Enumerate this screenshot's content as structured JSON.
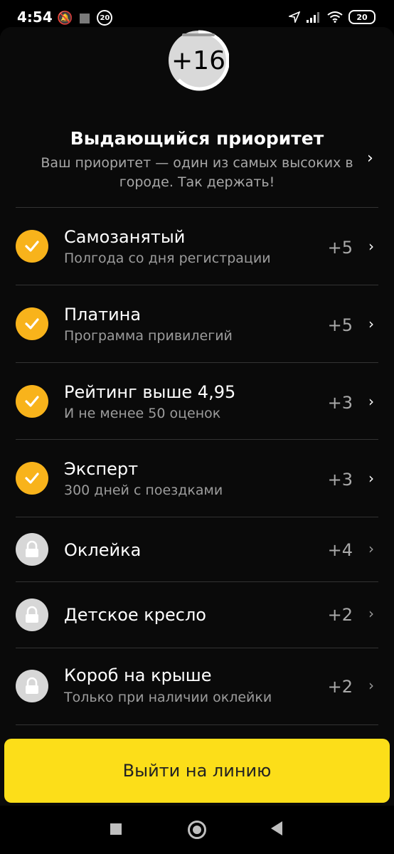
{
  "status_bar": {
    "time": "4:54",
    "badge": "20",
    "battery": "20"
  },
  "score": {
    "value": "+16"
  },
  "header": {
    "title": "Выдающийся приоритет",
    "subtitle": "Ваш приоритет — один из самых высоких в городе. Так держать!"
  },
  "items": [
    {
      "title": "Самозанятый",
      "subtitle": "Полгода со дня регистрации",
      "points": "+5",
      "status": "done",
      "icon": "check-icon"
    },
    {
      "title": "Платина",
      "subtitle": "Программа привилегий",
      "points": "+5",
      "status": "done",
      "icon": "check-icon"
    },
    {
      "title": "Рейтинг выше 4,95",
      "subtitle": "И не менее 50 оценок",
      "points": "+3",
      "status": "done",
      "icon": "check-icon"
    },
    {
      "title": "Эксперт",
      "subtitle": "300 дней с поездками",
      "points": "+3",
      "status": "done",
      "icon": "check-icon"
    },
    {
      "title": "Оклейка",
      "subtitle": "",
      "points": "+4",
      "status": "locked",
      "icon": "lock-icon"
    },
    {
      "title": "Детское кресло",
      "subtitle": "",
      "points": "+2",
      "status": "locked",
      "icon": "lock-icon"
    },
    {
      "title": "Короб на крыше",
      "subtitle": "Только при наличии оклейки",
      "points": "+2",
      "status": "locked",
      "icon": "lock-icon"
    }
  ],
  "cta": {
    "label": "Выйти на линию"
  },
  "colors": {
    "accent": "#fcde19",
    "check": "#f8b31b",
    "lock": "#d7d7d7"
  }
}
